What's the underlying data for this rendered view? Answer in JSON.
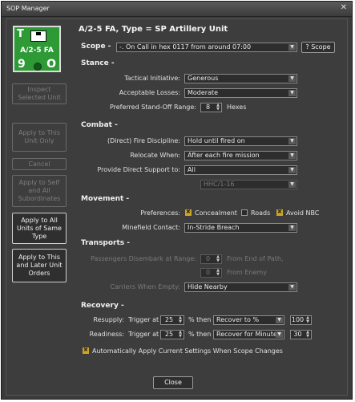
{
  "window": {
    "title": "SOP Manager",
    "close_glyph": "✕"
  },
  "unit_icon": {
    "letter": "T",
    "label": "A/2-5 FA",
    "left_num": "9",
    "right_letter": "O"
  },
  "header": {
    "title": "A/2-5 FA, Type = SP Artillery Unit"
  },
  "left_buttons": {
    "inspect": "Inspect Selected Unit",
    "apply_this": "Apply to This Unit Only",
    "cancel": "Cancel",
    "apply_self": "Apply to Self and All Subordinates",
    "apply_same_type": "Apply to All Units of Same Type",
    "apply_later": "Apply to This and Later Unit Orders"
  },
  "scope": {
    "label": "Scope -",
    "value": "-. On Call in hex 0117 from around 07:00",
    "button": "? Scope"
  },
  "stance": {
    "title": "Stance -",
    "tactical_label": "Tactical Initiative:",
    "tactical_value": "Generous",
    "losses_label": "Acceptable Losses:",
    "losses_value": "Moderate",
    "standoff_label": "Preferred Stand-Off Range:",
    "standoff_value": "8",
    "standoff_unit": "Hexes"
  },
  "combat": {
    "title": "Combat -",
    "fire_label": "(Direct) Fire Discipline:",
    "fire_value": "Hold until fired on",
    "relocate_label": "Relocate When:",
    "relocate_value": "After each fire mission",
    "support_label": "Provide Direct Support to:",
    "support_value": "All",
    "support_sub_value": "HHC/1-16"
  },
  "movement": {
    "title": "Movement -",
    "pref_label": "Preferences:",
    "concealment": "Concealment",
    "roads": "Roads",
    "avoid_nbc": "Avoid NBC",
    "minefield_label": "Minefield Contact:",
    "minefield_value": "In-Stride Breach"
  },
  "transports": {
    "title": "Transports -",
    "disembark_label": "Passengers Disembark at Range:",
    "disembark_value": "0",
    "disembark_unit": "From End of Path,",
    "enemy_value": "0",
    "enemy_unit": "From Enemy",
    "carriers_label": "Carriers When Empty:",
    "carriers_value": "Hide Nearby"
  },
  "recovery": {
    "title": "Recovery -",
    "resupply_label": "Resupply:",
    "trigger_at": "Trigger at",
    "resupply_trigger": "25",
    "pct_then": "% then",
    "resupply_action": "Recover to %",
    "resupply_amount": "100",
    "readiness_label": "Readiness:",
    "readiness_trigger": "25",
    "readiness_action": "Recover for Minutes",
    "readiness_amount": "30"
  },
  "auto_apply": "Automatically Apply Current Settings When Scope Changes",
  "close_button": "Close",
  "colors": {
    "icon_green": "#2e9a36",
    "check_yellow": "#caa52a",
    "panel": "#3d3d3d"
  }
}
